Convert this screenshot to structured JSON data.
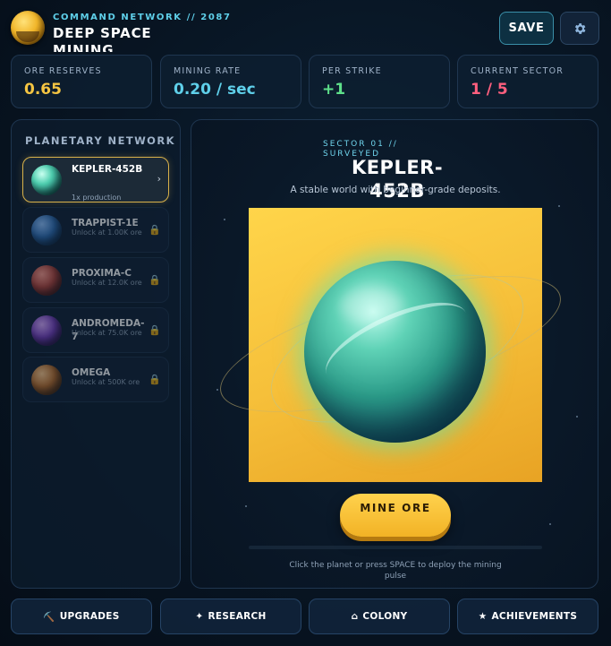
{
  "header": {
    "subtitle": "COMMAND NETWORK // 2087",
    "title": "DEEP SPACE MINING",
    "save_label": "SAVE",
    "settings_icon": "gear-icon",
    "logo_icon": "ore-coin-icon"
  },
  "stats": [
    {
      "label": "ORE RESERVES",
      "value": "0.65",
      "color": "#f5c542"
    },
    {
      "label": "MINING RATE",
      "value": "0.20 / sec",
      "color": "#5fd0ea"
    },
    {
      "label": "PER STRIKE",
      "value": "+1",
      "color": "#5ee08a"
    },
    {
      "label": "CURRENT SECTOR",
      "value": "1 / 5",
      "color": "#ff5f7e"
    }
  ],
  "sidebar": {
    "title": "PLANETARY NETWORK",
    "items": [
      {
        "name": "KEPLER-452B",
        "sub": "1x production",
        "locked": false,
        "active": true
      },
      {
        "name": "TRAPPIST-1E",
        "sub": "Unlock at 1.00K ore",
        "locked": true,
        "active": false
      },
      {
        "name": "PROXIMA-C",
        "sub": "Unlock at 12.0K ore",
        "locked": true,
        "active": false
      },
      {
        "name": "ANDROMEDA-7",
        "sub": "Unlock at 75.0K ore",
        "locked": true,
        "active": false
      },
      {
        "name": "OMEGA",
        "sub": "Unlock at 500K ore",
        "locked": true,
        "active": false
      }
    ]
  },
  "main": {
    "sector_label": "SECTOR 01 // SURVEYED",
    "planet_title": "KEPLER-452B",
    "planet_desc": "A stable world with beginner-grade deposits.",
    "mine_label": "MINE ORE",
    "hint": "Click the planet or press SPACE to deploy the mining pulse"
  },
  "nav": [
    {
      "icon": "⛏️",
      "label": "UPGRADES"
    },
    {
      "icon": "✦",
      "label": "RESEARCH"
    },
    {
      "icon": "⌂",
      "label": "COLONY"
    },
    {
      "icon": "★",
      "label": "ACHIEVEMENTS"
    }
  ]
}
